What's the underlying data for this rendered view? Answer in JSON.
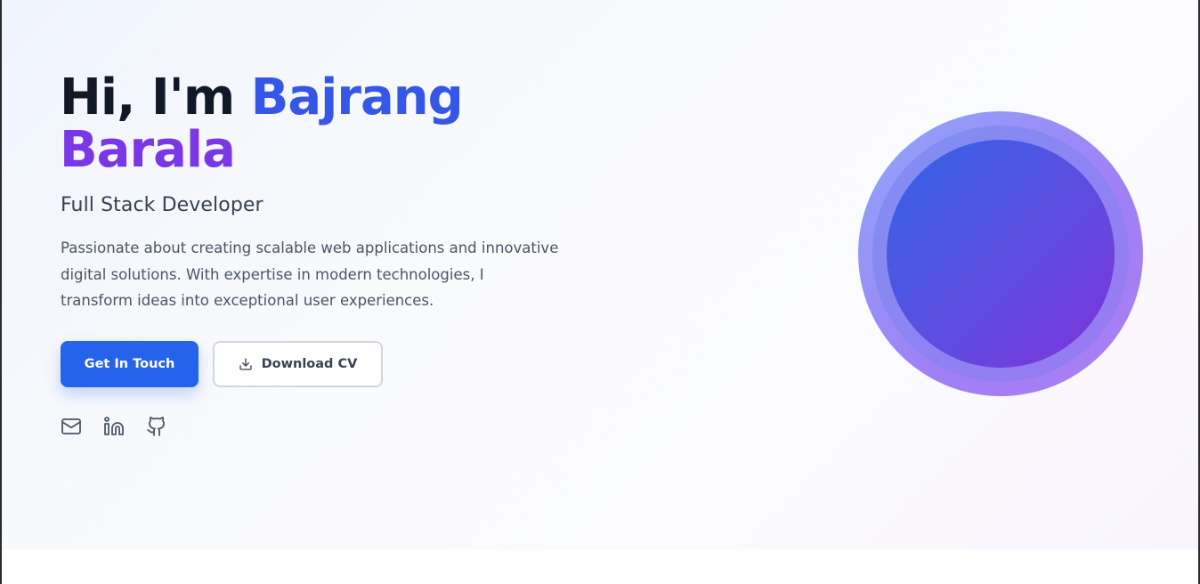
{
  "hero": {
    "greeting": "Hi, I'm ",
    "name_first": "Bajrang",
    "name_last": "Barala",
    "role": "Full Stack Developer",
    "description": "Passionate about creating scalable web applications and innovative digital solutions. With expertise in modern technologies, I transform ideas into exceptional user experiences.",
    "primary_button": "Get In Touch",
    "secondary_button": "Download CV",
    "social_icons": [
      "mail-icon",
      "linkedin-icon",
      "github-icon"
    ]
  },
  "colors": {
    "primary": "#2563eb",
    "heading": "#111827",
    "name_gradient_start": "#2f5fe0",
    "name_gradient_end": "#8a35e0",
    "avatar_gradient_start": "#3264e6",
    "avatar_gradient_end": "#7d34db"
  }
}
